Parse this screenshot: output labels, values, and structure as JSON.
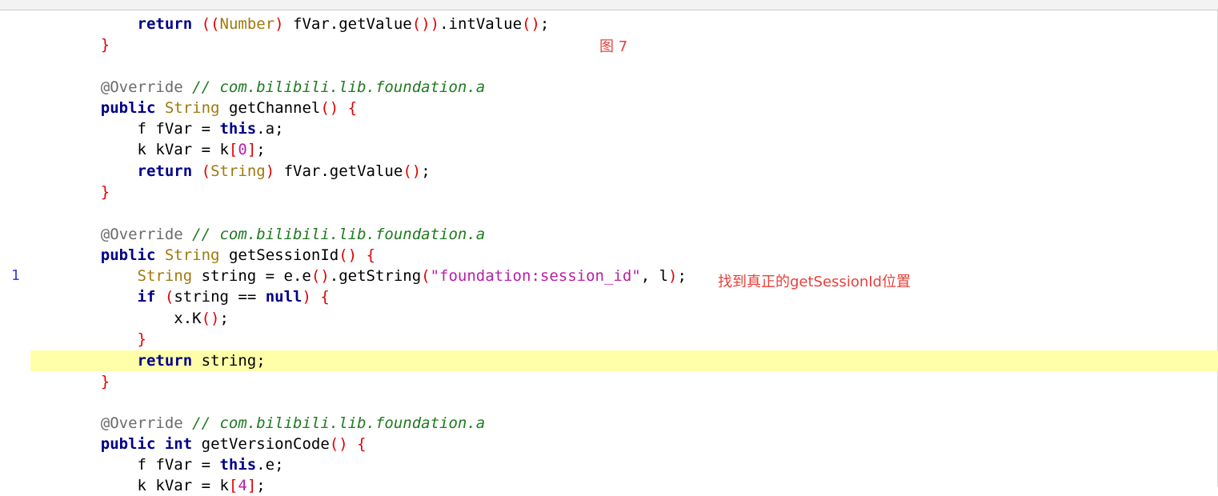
{
  "figure_label": "图 7",
  "annotation_text": "找到真正的getSessionId位置",
  "gutter_marker": "1",
  "colors": {
    "keyword": "#00008b",
    "type": "#a0790d",
    "bracket": "#e00000",
    "annotation_at": "#6b6b6b",
    "comment": "#1e7a1e",
    "string": "#b81fa6",
    "highlight_line": "#ffffaa",
    "red_annotation": "#e8403a"
  },
  "lines": [
    {
      "id": 0,
      "indent": "        ",
      "tokens": [
        {
          "t": "return",
          "c": "kw"
        },
        {
          "t": " ",
          "c": ""
        },
        {
          "t": "((",
          "c": "br"
        },
        {
          "t": "Number",
          "c": "type"
        },
        {
          "t": ")",
          "c": "br"
        },
        {
          "t": " fVar.getValue",
          "c": ""
        },
        {
          "t": "())",
          "c": "br"
        },
        {
          "t": ".intValue",
          "c": ""
        },
        {
          "t": "()",
          "c": "br"
        },
        {
          "t": ";",
          "c": ""
        }
      ]
    },
    {
      "id": 1,
      "indent": "    ",
      "tokens": [
        {
          "t": "}",
          "c": "br"
        }
      ]
    },
    {
      "id": 2,
      "indent": "",
      "tokens": []
    },
    {
      "id": 3,
      "indent": "    ",
      "tokens": [
        {
          "t": "@Override",
          "c": "ann"
        },
        {
          "t": " ",
          "c": ""
        },
        {
          "t": "// com.bilibili.lib.foundation.a",
          "c": "cm"
        }
      ]
    },
    {
      "id": 4,
      "indent": "    ",
      "tokens": [
        {
          "t": "public",
          "c": "kw"
        },
        {
          "t": " ",
          "c": ""
        },
        {
          "t": "String",
          "c": "type"
        },
        {
          "t": " getChannel",
          "c": ""
        },
        {
          "t": "()",
          "c": "br"
        },
        {
          "t": " ",
          "c": ""
        },
        {
          "t": "{",
          "c": "br"
        }
      ]
    },
    {
      "id": 5,
      "indent": "        ",
      "tokens": [
        {
          "t": "f fVar = ",
          "c": ""
        },
        {
          "t": "this",
          "c": "kw"
        },
        {
          "t": ".a;",
          "c": ""
        }
      ]
    },
    {
      "id": 6,
      "indent": "        ",
      "tokens": [
        {
          "t": "k kVar = k",
          "c": ""
        },
        {
          "t": "[",
          "c": "br"
        },
        {
          "t": "0",
          "c": "num"
        },
        {
          "t": "]",
          "c": "br"
        },
        {
          "t": ";",
          "c": ""
        }
      ]
    },
    {
      "id": 7,
      "indent": "        ",
      "tokens": [
        {
          "t": "return",
          "c": "kw"
        },
        {
          "t": " ",
          "c": ""
        },
        {
          "t": "(",
          "c": "br"
        },
        {
          "t": "String",
          "c": "type"
        },
        {
          "t": ")",
          "c": "br"
        },
        {
          "t": " fVar.getValue",
          "c": ""
        },
        {
          "t": "()",
          "c": "br"
        },
        {
          "t": ";",
          "c": ""
        }
      ]
    },
    {
      "id": 8,
      "indent": "    ",
      "tokens": [
        {
          "t": "}",
          "c": "br"
        }
      ]
    },
    {
      "id": 9,
      "indent": "",
      "tokens": []
    },
    {
      "id": 10,
      "indent": "    ",
      "tokens": [
        {
          "t": "@Override",
          "c": "ann"
        },
        {
          "t": " ",
          "c": ""
        },
        {
          "t": "// com.bilibili.lib.foundation.a",
          "c": "cm"
        }
      ]
    },
    {
      "id": 11,
      "indent": "    ",
      "tokens": [
        {
          "t": "public",
          "c": "kw"
        },
        {
          "t": " ",
          "c": ""
        },
        {
          "t": "String",
          "c": "type"
        },
        {
          "t": " getSessionId",
          "c": ""
        },
        {
          "t": "()",
          "c": "br"
        },
        {
          "t": " ",
          "c": ""
        },
        {
          "t": "{",
          "c": "br"
        }
      ]
    },
    {
      "id": 12,
      "indent": "        ",
      "tokens": [
        {
          "t": "String",
          "c": "type"
        },
        {
          "t": " string = e.e",
          "c": ""
        },
        {
          "t": "()",
          "c": "br"
        },
        {
          "t": ".getString",
          "c": ""
        },
        {
          "t": "(",
          "c": "br"
        },
        {
          "t": "\"foundation:session_id\"",
          "c": "str"
        },
        {
          "t": ", l",
          "c": ""
        },
        {
          "t": ")",
          "c": "br"
        },
        {
          "t": ";",
          "c": ""
        }
      ]
    },
    {
      "id": 13,
      "indent": "        ",
      "tokens": [
        {
          "t": "if",
          "c": "kw"
        },
        {
          "t": " ",
          "c": ""
        },
        {
          "t": "(",
          "c": "br"
        },
        {
          "t": "string == ",
          "c": ""
        },
        {
          "t": "null",
          "c": "kw"
        },
        {
          "t": ")",
          "c": "br"
        },
        {
          "t": " ",
          "c": ""
        },
        {
          "t": "{",
          "c": "br"
        }
      ]
    },
    {
      "id": 14,
      "indent": "            ",
      "tokens": [
        {
          "t": "x.K",
          "c": ""
        },
        {
          "t": "()",
          "c": "br"
        },
        {
          "t": ";",
          "c": ""
        }
      ]
    },
    {
      "id": 15,
      "indent": "        ",
      "tokens": [
        {
          "t": "}",
          "c": "br"
        }
      ]
    },
    {
      "id": 16,
      "indent": "        ",
      "tokens": [
        {
          "t": "return",
          "c": "kw"
        },
        {
          "t": " string;",
          "c": ""
        }
      ]
    },
    {
      "id": 17,
      "indent": "    ",
      "tokens": [
        {
          "t": "}",
          "c": "br"
        }
      ]
    },
    {
      "id": 18,
      "indent": "",
      "tokens": []
    },
    {
      "id": 19,
      "indent": "    ",
      "tokens": [
        {
          "t": "@Override",
          "c": "ann"
        },
        {
          "t": " ",
          "c": ""
        },
        {
          "t": "// com.bilibili.lib.foundation.a",
          "c": "cm"
        }
      ]
    },
    {
      "id": 20,
      "indent": "    ",
      "tokens": [
        {
          "t": "public",
          "c": "kw"
        },
        {
          "t": " ",
          "c": ""
        },
        {
          "t": "int",
          "c": "kw"
        },
        {
          "t": " getVersionCode",
          "c": ""
        },
        {
          "t": "()",
          "c": "br"
        },
        {
          "t": " ",
          "c": ""
        },
        {
          "t": "{",
          "c": "br"
        }
      ]
    },
    {
      "id": 21,
      "indent": "        ",
      "tokens": [
        {
          "t": "f fVar = ",
          "c": ""
        },
        {
          "t": "this",
          "c": "kw"
        },
        {
          "t": ".e;",
          "c": ""
        }
      ]
    },
    {
      "id": 22,
      "indent": "        ",
      "tokens": [
        {
          "t": "k kVar = k",
          "c": ""
        },
        {
          "t": "[",
          "c": "br"
        },
        {
          "t": "4",
          "c": "num"
        },
        {
          "t": "]",
          "c": "br"
        },
        {
          "t": ";",
          "c": ""
        }
      ]
    }
  ]
}
